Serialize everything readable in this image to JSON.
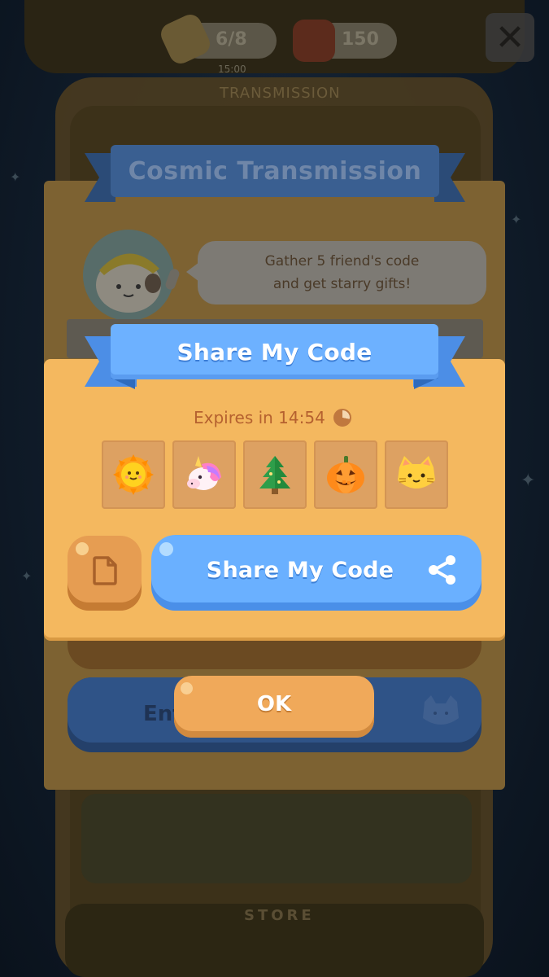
{
  "top_bar": {
    "energy_value": "6/8",
    "energy_timer": "15:00",
    "ticket_value": "150",
    "subtitle": "TRANSMISSION"
  },
  "background": {
    "bottom_label": "STORE"
  },
  "cosmic_dialog": {
    "title": "Cosmic Transmission",
    "bubble_line1": "Gather 5 friend's code",
    "bubble_line2": "and get starry gifts!",
    "enter_button_label": "Ent"
  },
  "share_dialog": {
    "title": "Share My Code",
    "expires_text": "Expires in 14:54",
    "code_tiles": [
      {
        "icon": "sun-icon"
      },
      {
        "icon": "unicorn-icon"
      },
      {
        "icon": "tree-icon"
      },
      {
        "icon": "pumpkin-icon"
      },
      {
        "icon": "cat-icon"
      }
    ],
    "share_button_label": "Share My Code",
    "ok_button_label": "OK"
  },
  "colors": {
    "panel": "#f4b85f",
    "ribbon_blue": "#6db1ff",
    "share_button": "#6ab0ff",
    "ok_button": "#f0a95a",
    "expires_text": "#b5612f"
  }
}
